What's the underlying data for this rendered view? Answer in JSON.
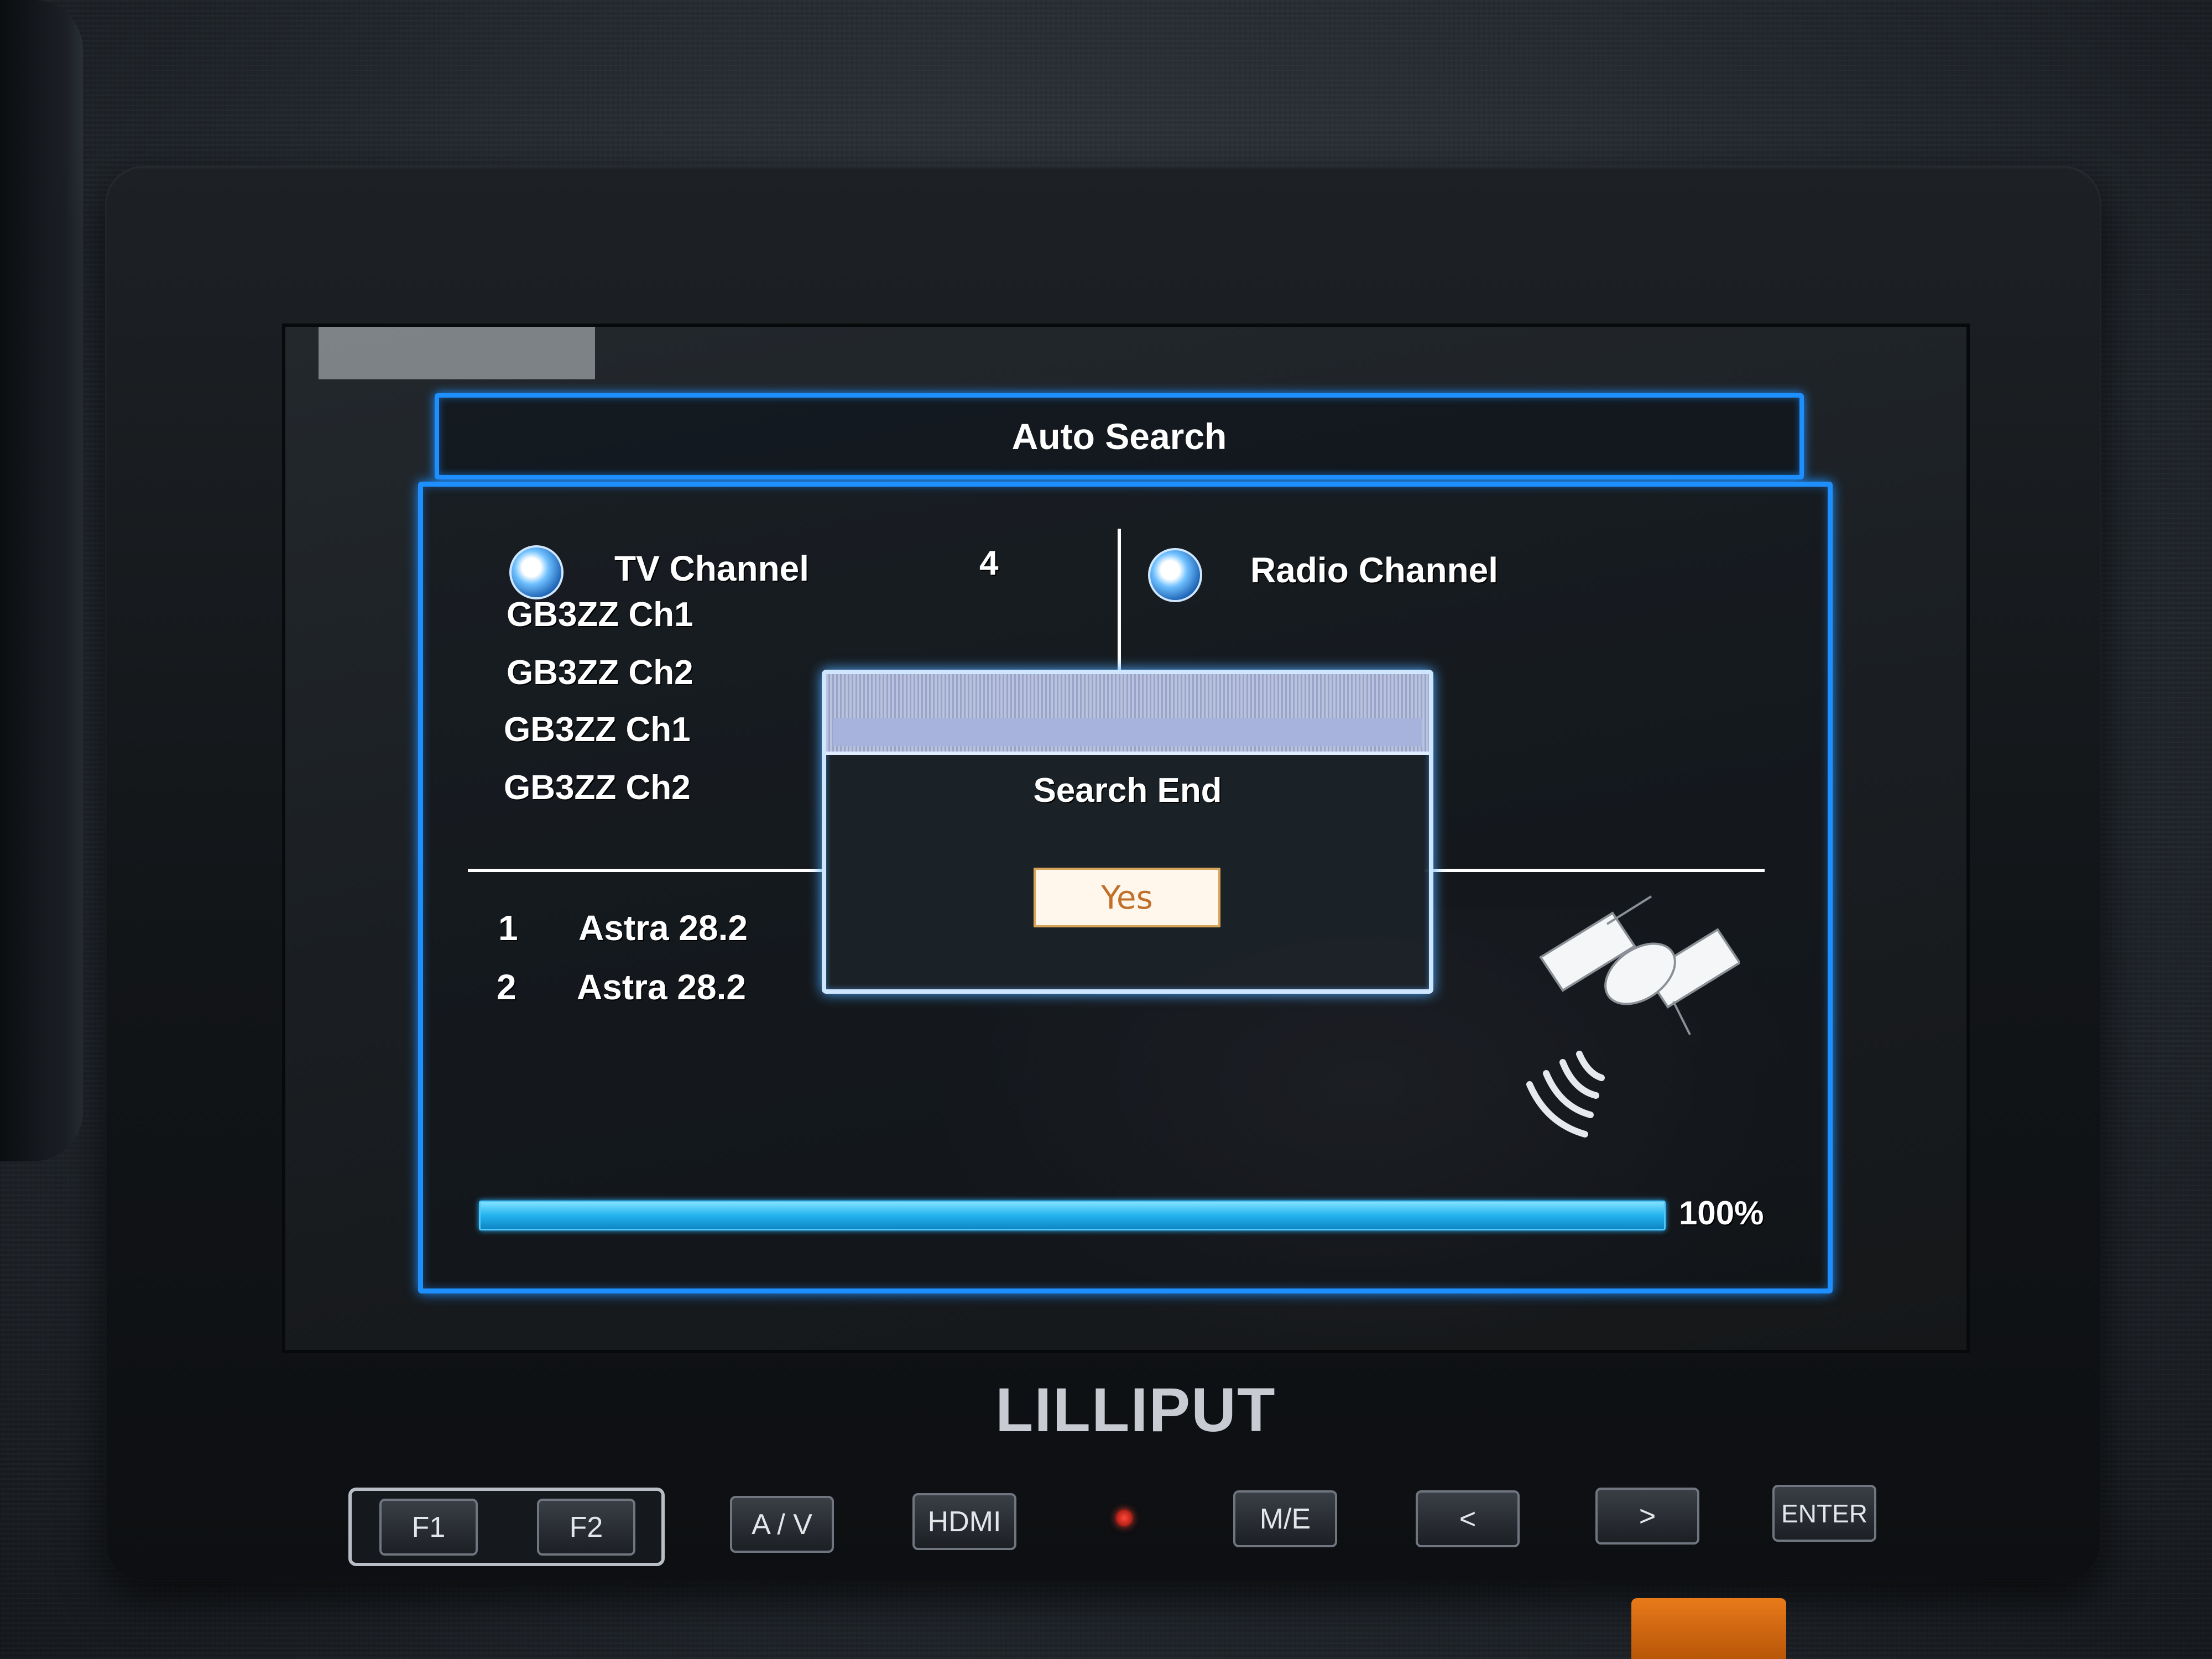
{
  "osd": {
    "title": "Auto Search",
    "tv_section": {
      "label": "TV Channel",
      "count": "4",
      "channels": [
        "GB3ZZ Ch1",
        "GB3ZZ Ch2",
        "GB3ZZ Ch1",
        "GB3ZZ Ch2"
      ]
    },
    "radio_section": {
      "label": "Radio Channel"
    },
    "transponders": [
      {
        "num": "1",
        "name": "Astra 28.2"
      },
      {
        "num": "2",
        "name": "Astra 28.2"
      }
    ],
    "progress": {
      "value": 100,
      "label": "100%"
    }
  },
  "dialog": {
    "message": "Search End",
    "confirm_label": "Yes"
  },
  "monitor": {
    "brand": "LILLIPUT",
    "buttons": {
      "f1": "F1",
      "f2": "F2",
      "av": "A / V",
      "hdmi": "HDMI",
      "me": "M/E",
      "left": "<",
      "right": ">",
      "enter": "ENTER"
    }
  },
  "colors": {
    "osd_border": "#1e8fff",
    "progress_fill": "#23b3f0",
    "yes_text": "#c0702a",
    "led": "#ff3a2a"
  }
}
